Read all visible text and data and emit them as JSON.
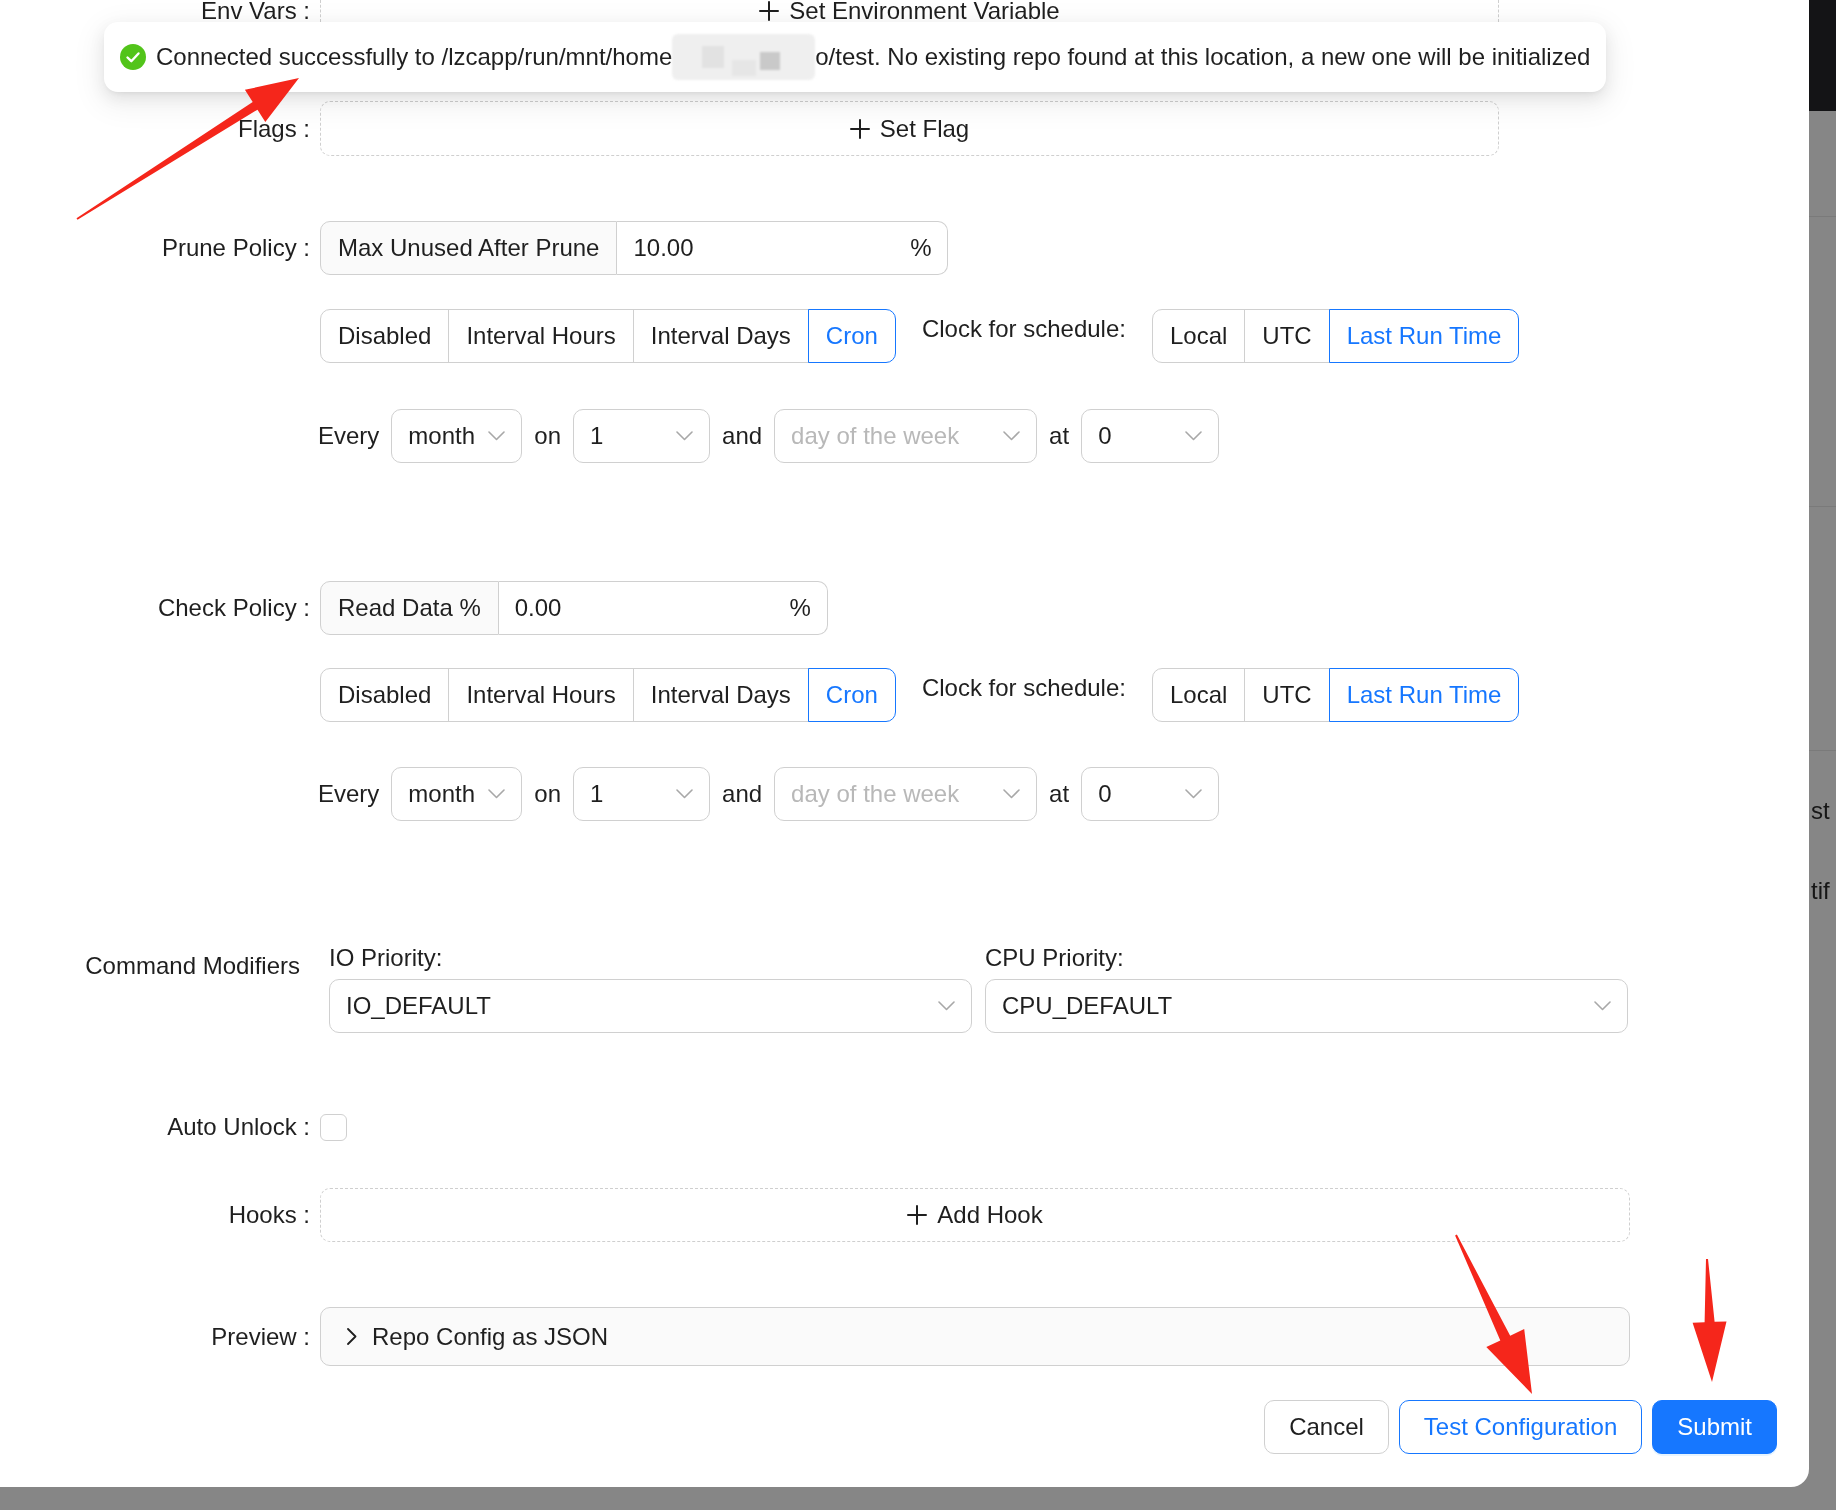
{
  "toast": {
    "kind": "success",
    "message_parts": [
      "Connected successfully to /lzcapp/run/mnt/home",
      "o/test. No existing repo found at this location, a new one will be initialized"
    ]
  },
  "form": {
    "env_vars": {
      "label": "Env Vars :",
      "button": "Set Environment Variable"
    },
    "flags": {
      "label": "Flags :",
      "button": "Set Flag"
    },
    "policies": [
      {
        "label": "Prune Policy :",
        "addon": "Max Unused After Prune",
        "value": "10.00",
        "suffix": "%",
        "modes": [
          {
            "label": "Disabled",
            "selected": false
          },
          {
            "label": "Interval Hours",
            "selected": false
          },
          {
            "label": "Interval Days",
            "selected": false
          },
          {
            "label": "Cron",
            "selected": true
          }
        ],
        "clock_label": "Clock for schedule:",
        "clocks": [
          {
            "label": "Local",
            "selected": false
          },
          {
            "label": "UTC",
            "selected": false
          },
          {
            "label": "Last Run Time",
            "selected": true
          }
        ],
        "cron": [
          {
            "kind": "text",
            "text": "Every"
          },
          {
            "kind": "select",
            "value": "month"
          },
          {
            "kind": "text",
            "text": "on"
          },
          {
            "kind": "select",
            "value": "1"
          },
          {
            "kind": "text",
            "text": "and"
          },
          {
            "kind": "select",
            "placeholder": "day of the week"
          },
          {
            "kind": "text",
            "text": "at"
          },
          {
            "kind": "select",
            "value": "0"
          }
        ]
      },
      {
        "label": "Check Policy :",
        "addon": "Read Data %",
        "value": "0.00",
        "suffix": "%",
        "modes": [
          {
            "label": "Disabled",
            "selected": false
          },
          {
            "label": "Interval Hours",
            "selected": false
          },
          {
            "label": "Interval Days",
            "selected": false
          },
          {
            "label": "Cron",
            "selected": true
          }
        ],
        "clock_label": "Clock for schedule:",
        "clocks": [
          {
            "label": "Local",
            "selected": false
          },
          {
            "label": "UTC",
            "selected": false
          },
          {
            "label": "Last Run Time",
            "selected": true
          }
        ],
        "cron": [
          {
            "kind": "text",
            "text": "Every"
          },
          {
            "kind": "select",
            "value": "month"
          },
          {
            "kind": "text",
            "text": "on"
          },
          {
            "kind": "select",
            "value": "1"
          },
          {
            "kind": "text",
            "text": "and"
          },
          {
            "kind": "select",
            "placeholder": "day of the week"
          },
          {
            "kind": "text",
            "text": "at"
          },
          {
            "kind": "select",
            "value": "0"
          }
        ]
      }
    ],
    "command_modifiers": {
      "label": "Command Modifiers",
      "fields": [
        {
          "label": "IO Priority:",
          "value": "IO_DEFAULT"
        },
        {
          "label": "CPU Priority:",
          "value": "CPU_DEFAULT"
        }
      ]
    },
    "auto_unlock": {
      "label": "Auto Unlock :",
      "checked": false
    },
    "hooks": {
      "label": "Hooks :",
      "button": "Add Hook"
    },
    "preview": {
      "label": "Preview :",
      "title": "Repo Config as JSON",
      "expanded": false
    }
  },
  "footer_buttons": [
    {
      "label": "Cancel",
      "kind": "default"
    },
    {
      "label": "Test Configuration",
      "kind": "outline"
    },
    {
      "label": "Submit",
      "kind": "primary"
    }
  ],
  "background_page": {
    "text_fragments": [
      "st",
      "tif"
    ]
  },
  "annotations": [
    {
      "kind": "arrow"
    },
    {
      "kind": "arrow"
    },
    {
      "kind": "arrow"
    }
  ]
}
